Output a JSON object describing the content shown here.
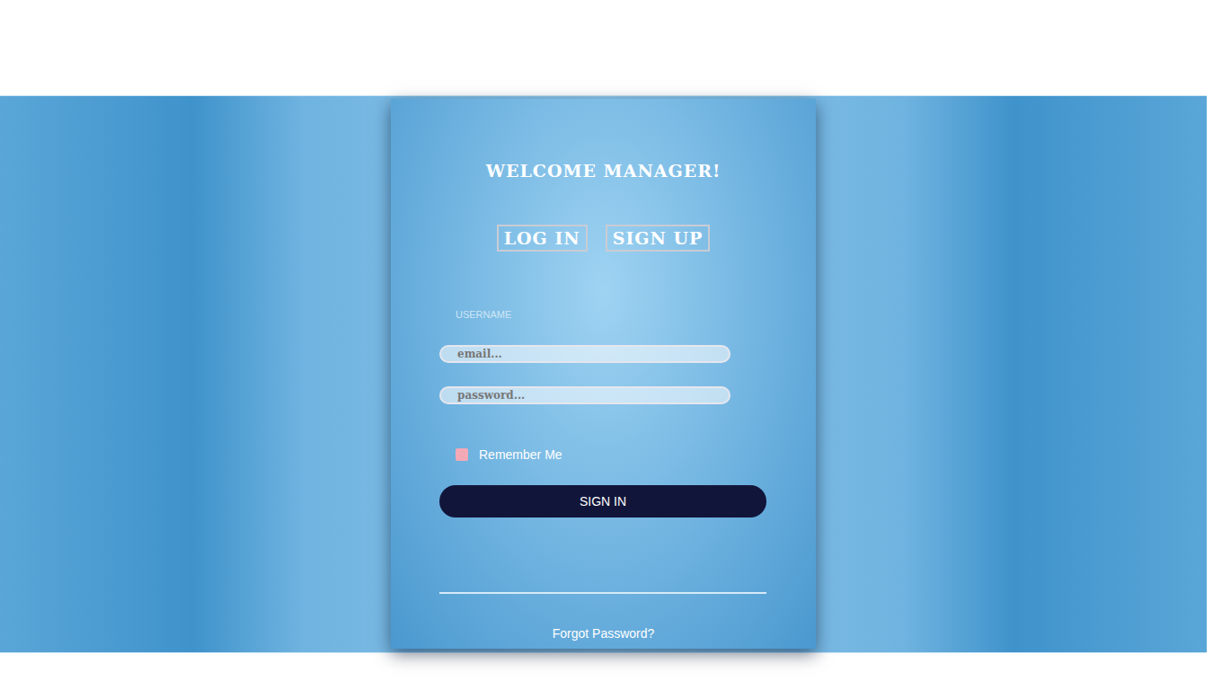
{
  "login_card": {
    "title": "WELCOME MANAGER!",
    "tabs": [
      {
        "label": "LOG IN"
      },
      {
        "label": "SIGN UP"
      }
    ],
    "username_label": "USERNAME",
    "fields": [
      {
        "placeholder": "email..."
      },
      {
        "placeholder": "password..."
      }
    ],
    "remember": {
      "label": "Remember Me",
      "checked": false
    },
    "button": "SIGN IN",
    "forgot": "Forgot Password?"
  }
}
